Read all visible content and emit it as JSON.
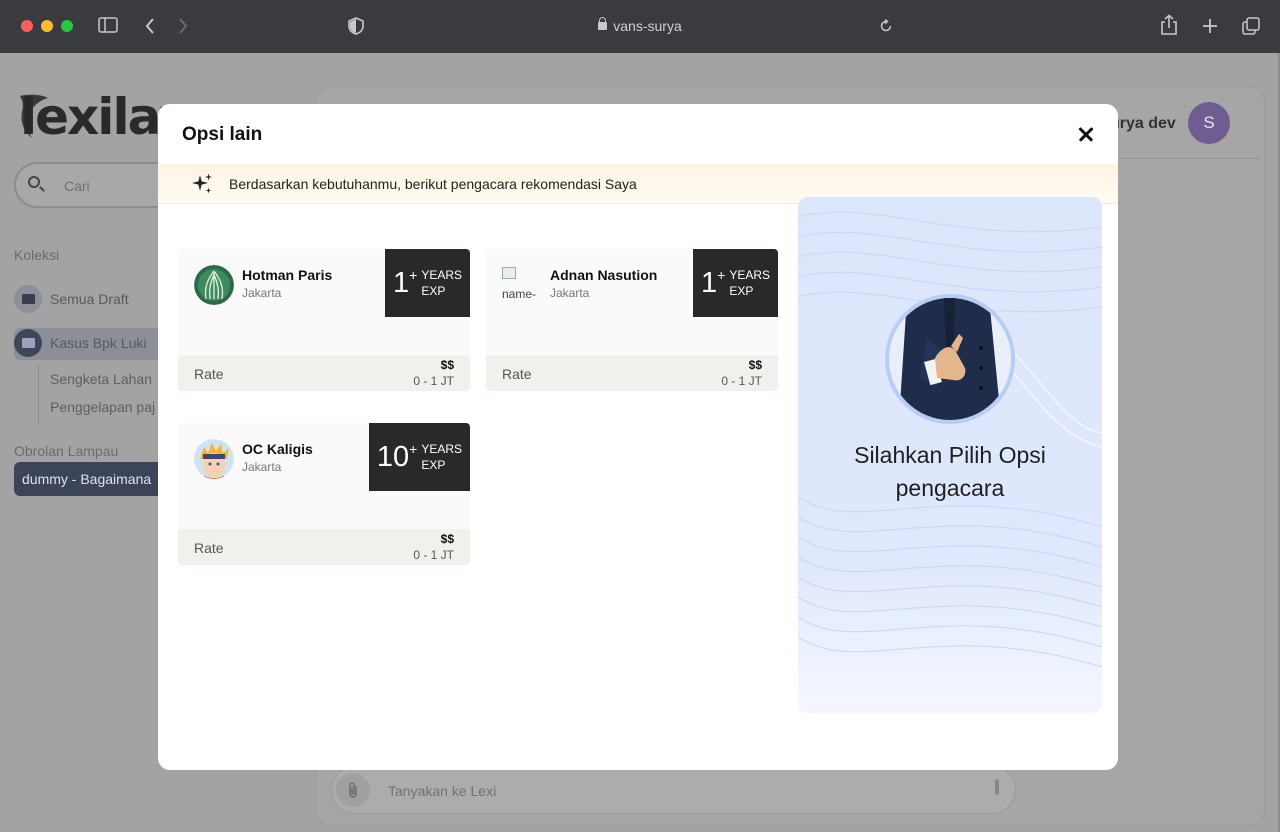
{
  "browser": {
    "url": "vans-surya",
    "icons": [
      "sidebar-toggle-icon",
      "back-icon",
      "forward-icon",
      "shield-icon",
      "lock-icon",
      "reload-icon",
      "share-icon",
      "new-tab-icon",
      "tabs-overview-icon"
    ]
  },
  "app": {
    "logo_text": "lexilav",
    "search_placeholder": "Cari",
    "collections_label": "Koleksi",
    "folders": [
      {
        "label": "Semua Draft"
      },
      {
        "label": "Kasus Bpk Luki"
      }
    ],
    "subfolders": [
      "Sengketa Lahan",
      "Penggelapan paj"
    ],
    "recent_label": "Obrolan Lampau",
    "recent_chat": "dummy - Bagaimana",
    "user_name": "urya dev",
    "user_initial": "S",
    "chat_placeholder": "Tanyakan ke Lexi"
  },
  "modal": {
    "title": "Opsi lain",
    "banner_text": "Berdasarkan kebutuhanmu, berikut pengacara rekomendasi Saya",
    "panel_text": "Silahkan Pilih Opsi pengacara",
    "lawyers": [
      {
        "name": "Hotman Paris",
        "city": "Jakarta",
        "years": "1",
        "plus": "+",
        "years_label": "YEARS",
        "exp_label": "EXP",
        "rate_label": "Rate",
        "price": "$$",
        "range": "0 - 1 JT"
      },
      {
        "name": "Adnan Nasution",
        "city": "Jakarta",
        "alt_text": "name-",
        "years": "1",
        "plus": "+",
        "years_label": "YEARS",
        "exp_label": "EXP",
        "rate_label": "Rate",
        "price": "$$",
        "range": "0 - 1 JT"
      },
      {
        "name": "OC Kaligis",
        "city": "Jakarta",
        "years": "10",
        "plus": "+",
        "years_label": "YEARS",
        "exp_label": "EXP",
        "rate_label": "Rate",
        "price": "$$",
        "range": "0 - 1 JT"
      }
    ]
  },
  "colors": {
    "overlay": "#a3a3a3",
    "exp_badge": "#2b2928",
    "panel_blue": "#dce6fb",
    "banner": "#fdf4e3",
    "active_chat": "#3c4459",
    "avatar": "#6f5d92"
  }
}
